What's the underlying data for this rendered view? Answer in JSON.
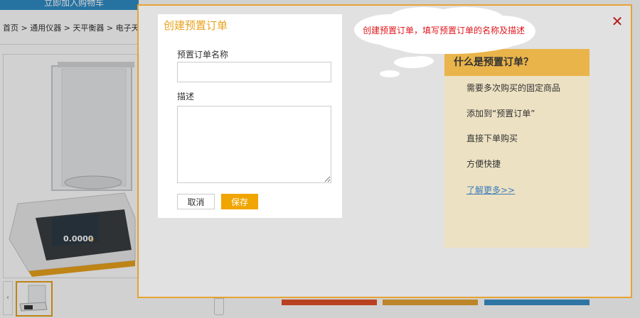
{
  "background": {
    "top_bar_label": "立即加入购物车",
    "breadcrumb": "首页 > 通用仪器 > 天平衡器 > 电子天平",
    "display_readout": "0.0000",
    "display_unit": "g"
  },
  "modal": {
    "close_glyph": "✕",
    "form": {
      "title": "创建预置订单",
      "name_label": "预置订单名称",
      "name_value": "",
      "desc_label": "描述",
      "desc_value": "",
      "cancel_label": "取消",
      "save_label": "保存"
    },
    "tooltip": "创建预置订单，填写预置订单的名称及描述",
    "info": {
      "title": "什么是预置订单？",
      "items": [
        "需要多次购买的固定商品",
        "添加到“预置订单”",
        "直接下单购买",
        "方便快捷"
      ],
      "link": "了解更多>>"
    }
  },
  "colors": {
    "accent": "#f0a500",
    "title": "#e8a21c",
    "modal_border": "#e6a334",
    "info_head": "#e9b44a",
    "tooltip_text": "#e0161b",
    "close": "#b31b1b",
    "link": "#3a7bbd"
  }
}
